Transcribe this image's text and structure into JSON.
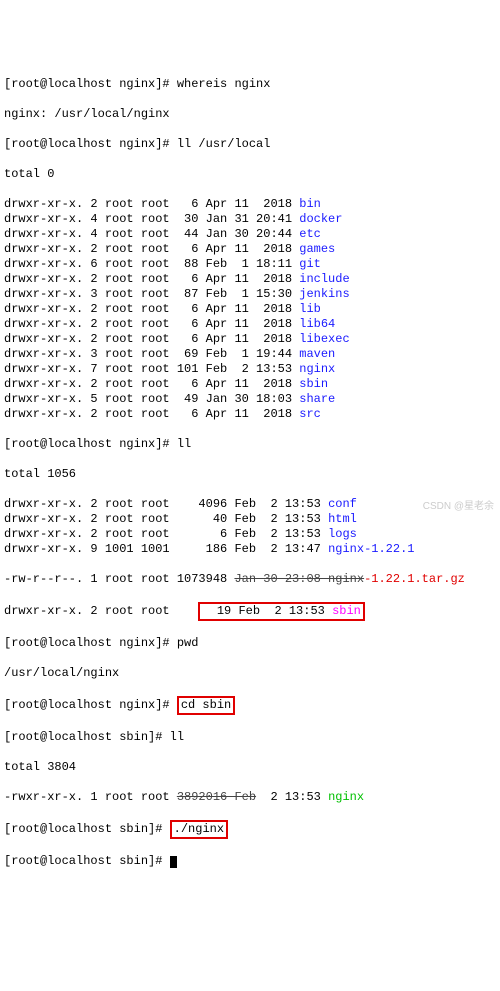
{
  "prompt1": "[root@localhost nginx]# ",
  "prompt2": "[root@localhost sbin]# ",
  "cmd_whereis": "whereis nginx",
  "whereis_out": "nginx: /usr/local/nginx",
  "cmd_ll1": "ll /usr/local",
  "total0": "total 0",
  "ls1": [
    {
      "perm": "drwxr-xr-x. 2 root root   6 Apr 11  2018 ",
      "name": "bin",
      "cls": "blue"
    },
    {
      "perm": "drwxr-xr-x. 4 root root  30 Jan 31 20:41 ",
      "name": "docker",
      "cls": "blue"
    },
    {
      "perm": "drwxr-xr-x. 4 root root  44 Jan 30 20:44 ",
      "name": "etc",
      "cls": "blue"
    },
    {
      "perm": "drwxr-xr-x. 2 root root   6 Apr 11  2018 ",
      "name": "games",
      "cls": "blue"
    },
    {
      "perm": "drwxr-xr-x. 6 root root  88 Feb  1 18:11 ",
      "name": "git",
      "cls": "blue"
    },
    {
      "perm": "drwxr-xr-x. 2 root root   6 Apr 11  2018 ",
      "name": "include",
      "cls": "blue"
    },
    {
      "perm": "drwxr-xr-x. 3 root root  87 Feb  1 15:30 ",
      "name": "jenkins",
      "cls": "blue"
    },
    {
      "perm": "drwxr-xr-x. 2 root root   6 Apr 11  2018 ",
      "name": "lib",
      "cls": "blue"
    },
    {
      "perm": "drwxr-xr-x. 2 root root   6 Apr 11  2018 ",
      "name": "lib64",
      "cls": "blue"
    },
    {
      "perm": "drwxr-xr-x. 2 root root   6 Apr 11  2018 ",
      "name": "libexec",
      "cls": "blue"
    },
    {
      "perm": "drwxr-xr-x. 3 root root  69 Feb  1 19:44 ",
      "name": "maven",
      "cls": "blue"
    },
    {
      "perm": "drwxr-xr-x. 7 root root 101 Feb  2 13:53 ",
      "name": "nginx",
      "cls": "blue"
    },
    {
      "perm": "drwxr-xr-x. 2 root root   6 Apr 11  2018 ",
      "name": "sbin",
      "cls": "blue"
    },
    {
      "perm": "drwxr-xr-x. 5 root root  49 Jan 30 18:03 ",
      "name": "share",
      "cls": "blue"
    },
    {
      "perm": "drwxr-xr-x. 2 root root   6 Apr 11  2018 ",
      "name": "src",
      "cls": "blue"
    }
  ],
  "cmd_ll2": "ll",
  "total1056": "total 1056",
  "ls2": [
    {
      "perm": "drwxr-xr-x. 2 root root    4096 Feb  2 13:53 ",
      "name": "conf",
      "cls": "blue"
    },
    {
      "perm": "drwxr-xr-x. 2 root root      40 Feb  2 13:53 ",
      "name": "html",
      "cls": "blue"
    },
    {
      "perm": "drwxr-xr-x. 2 root root       6 Feb  2 13:53 ",
      "name": "logs",
      "cls": "blue"
    },
    {
      "perm": "drwxr-xr-x. 9 1001 1001     186 Feb  2 13:47 ",
      "name": "nginx-1.22.1",
      "cls": "blue"
    }
  ],
  "tar_perm": "-rw-r--r--. 1 root root 1073948 ",
  "tar_strike": "Jan 30 23:08 nginx",
  "tar_suffix": "-1.22.1.tar.gz",
  "sbin_perm": "drwxr-xr-x. 2 root root    ",
  "sbin_box": "  19 Feb  2 13:53 ",
  "sbin_name": "sbin",
  "cmd_pwd": "pwd",
  "pwd_out": "/usr/local/nginx",
  "cmd_cdsbin": "cd sbin",
  "cmd_ll3": "ll",
  "total3804": "total 3804",
  "nginx_perm": "-rwxr-xr-x. 1 root root ",
  "nginx_strike": "3892016 Feb",
  "nginx_rest": "  2 13:53 ",
  "nginx_name": "nginx",
  "cmd_run": "./nginx",
  "watermark": "CSDN @星老余"
}
